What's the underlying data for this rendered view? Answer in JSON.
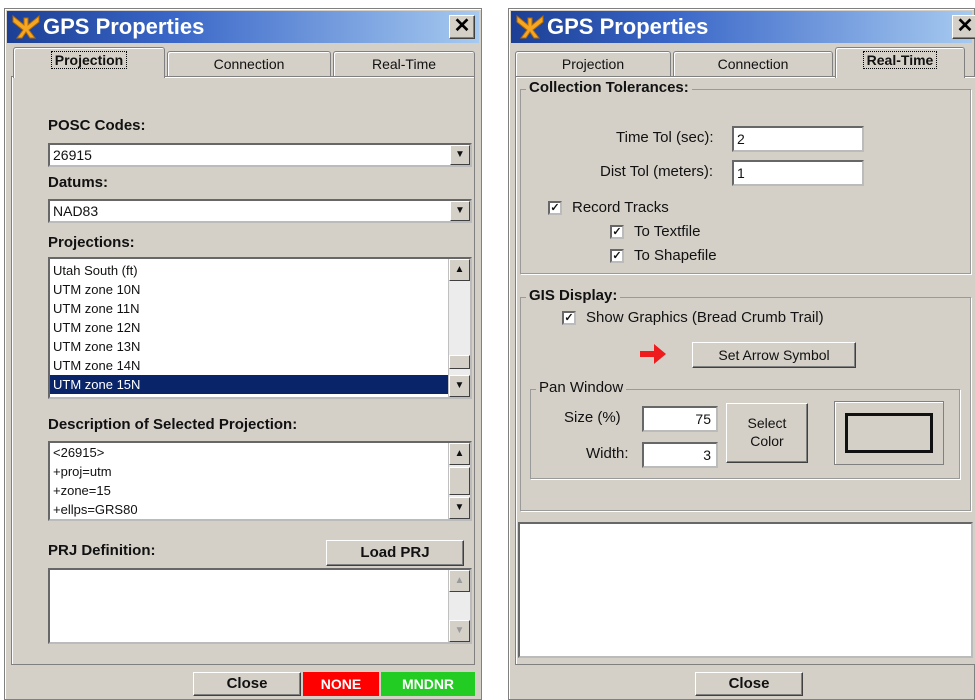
{
  "windows": [
    {
      "title": "GPS Properties",
      "close_glyph": "✕",
      "tabs": [
        {
          "label": "Projection",
          "active": true
        },
        {
          "label": "Connection",
          "active": false
        },
        {
          "label": "Real-Time",
          "active": false
        }
      ],
      "projection_panel": {
        "posc_label": "POSC Codes:",
        "posc_value": "26915",
        "datums_label": "Datums:",
        "datums_value": "NAD83",
        "projections_label": "Projections:",
        "projections": [
          "Utah South (ft)",
          "UTM zone 10N",
          "UTM zone 11N",
          "UTM zone 12N",
          "UTM zone 13N",
          "UTM zone 14N",
          "UTM zone 15N"
        ],
        "selected_projection": "UTM zone 15N",
        "description_label": "Description of Selected Projection:",
        "description_lines": [
          "<26915>",
          "+proj=utm",
          "+zone=15",
          "+ellps=GRS80"
        ],
        "prj_label": "PRJ Definition:",
        "load_prj_label": "Load PRJ",
        "prj_text": ""
      },
      "footer": {
        "close_label": "Close",
        "status_none": "NONE",
        "status_mndnr": "MNDNR",
        "status_none_color": "#ff0000",
        "status_mndnr_color": "#22cc22"
      }
    },
    {
      "title": "GPS Properties",
      "close_glyph": "✕",
      "tabs": [
        {
          "label": "Projection",
          "active": false
        },
        {
          "label": "Connection",
          "active": false
        },
        {
          "label": "Real-Time",
          "active": true
        }
      ],
      "realtime_panel": {
        "collection_group": "Collection Tolerances:",
        "time_tol_label": "Time Tol (sec):",
        "time_tol_value": "2",
        "dist_tol_label": "Dist Tol (meters):",
        "dist_tol_value": "1",
        "record_tracks_label": "Record Tracks",
        "record_tracks_checked": true,
        "to_textfile_label": "To Textfile",
        "to_textfile_checked": true,
        "to_shapefile_label": "To Shapefile",
        "to_shapefile_checked": true,
        "gis_group": "GIS Display:",
        "show_graphics_label": "Show Graphics (Bread Crumb Trail)",
        "show_graphics_checked": true,
        "arrow_color": "#ee1c1c",
        "set_arrow_label": "Set Arrow Symbol",
        "pan_group": "Pan Window",
        "size_label": "Size (%)",
        "size_value": "75",
        "width_label": "Width:",
        "width_value": "3",
        "select_color_label_1": "Select",
        "select_color_label_2": "Color",
        "log_text": ""
      },
      "footer": {
        "close_label": "Close"
      }
    }
  ],
  "colors": {
    "titlebar_start": "#1c3f94",
    "titlebar_end": "#a6caf0",
    "dialog_bg": "#d4d0c8",
    "selection": "#0a246a",
    "logo": "#f5a623"
  },
  "icons": {
    "app_logo": "airplane-logo-icon",
    "close": "close-icon",
    "dropdown": "chevron-down-icon",
    "scroll_up": "scroll-up-icon",
    "scroll_down": "scroll-down-icon",
    "arrow_symbol": "right-arrow-icon"
  }
}
